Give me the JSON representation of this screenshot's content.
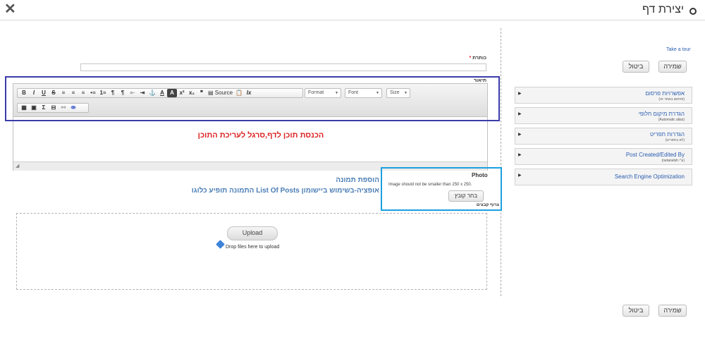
{
  "header": {
    "title": "יצירת דף"
  },
  "sidebar": {
    "tour_link": "Take a tour",
    "save_label": "שמירה",
    "cancel_label": "ביטול",
    "panels": [
      {
        "title": "אפשרויות פרסום",
        "subtitle": "(פרסום באתר זה)"
      },
      {
        "title": "הגדרת מיקום חלופי",
        "subtitle": "(Automatic alias)"
      },
      {
        "title": "הגדרות תפריט",
        "subtitle": "(לא בתפריט)"
      },
      {
        "title": "Post Created/Edited By",
        "subtitle": "(ע\"י netanelsh)"
      },
      {
        "title": "Search Engine Optimization",
        "subtitle": ""
      }
    ]
  },
  "form": {
    "title_label": "כותרת",
    "required_mark": "*",
    "description_label": "תיאור",
    "editor": {
      "source_label": "Source",
      "format_label": "Format",
      "font_label": "Font",
      "size_label": "Size"
    },
    "photo_label": "Photo",
    "photo_hint": "Image should not be smaller than 250 x 250.",
    "choose_file_label": "בחר קובץ",
    "attachments_label": "צרוף קבצים",
    "upload_label": "Upload",
    "drop_hint": "Drop files here to upload"
  },
  "annotations": {
    "editor_note": "הכנסת תוכן לדף,סרגל לעריכת התוכן",
    "photo_note_1": "הוספת תמונה",
    "photo_note_2": "אופציה-בשימוש ביישומון List Of Posts התמונה תופיע כלוגו"
  },
  "colors": {
    "annotation_red": "#d22222",
    "annotation_blue": "#4a7db5",
    "editor_box": "#3c3caa",
    "photo_box": "#1ba0e0",
    "link": "#2a5db0"
  }
}
